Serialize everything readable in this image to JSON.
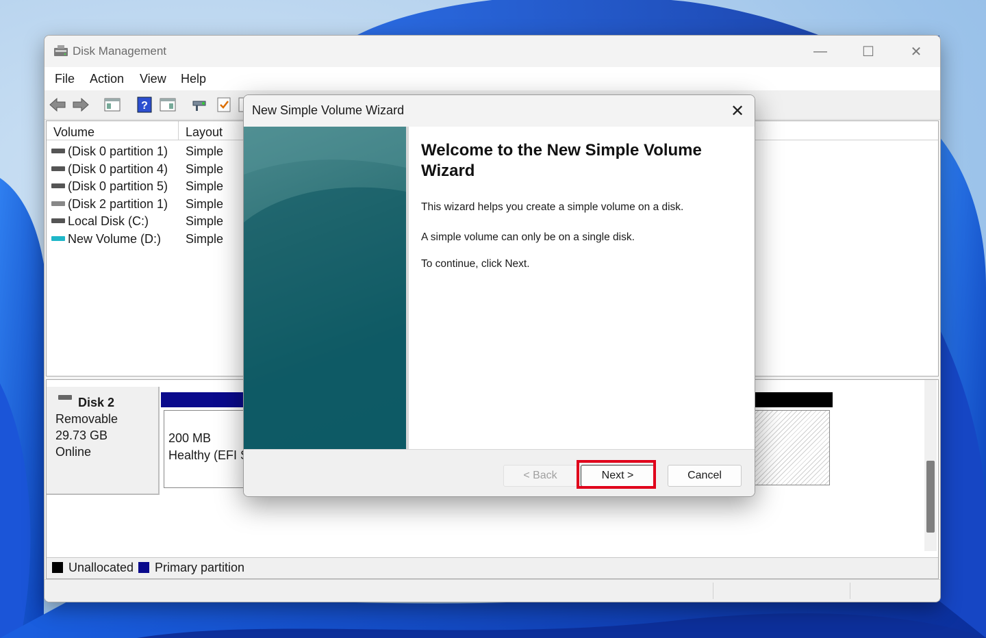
{
  "window": {
    "title": "Disk Management",
    "controls": {
      "minimize": "—",
      "maximize": "☐",
      "close": "✕"
    }
  },
  "menu": [
    "File",
    "Action",
    "View",
    "Help"
  ],
  "toolbar": [
    "back-arrow-icon",
    "forward-arrow-icon",
    "properties-pane-icon",
    "help-icon",
    "show-pane-icon",
    "connect-icon",
    "check-icon",
    "more-icon"
  ],
  "volume_list": {
    "columns": [
      "Volume",
      "Layout"
    ],
    "rows": [
      {
        "name": "(Disk 0 partition 1)",
        "layout": "Simple",
        "icon": "disk-icon"
      },
      {
        "name": "(Disk 0 partition 4)",
        "layout": "Simple",
        "icon": "disk-icon"
      },
      {
        "name": "(Disk 0 partition 5)",
        "layout": "Simple",
        "icon": "disk-icon"
      },
      {
        "name": "(Disk 2 partition 1)",
        "layout": "Simple",
        "icon": "disk-icon"
      },
      {
        "name": "Local Disk (C:)",
        "layout": "Simple",
        "icon": "disk-icon"
      },
      {
        "name": "New Volume (D:)",
        "layout": "Simple",
        "icon": "usb-disk-icon"
      }
    ]
  },
  "disk_map": {
    "disk": {
      "name": "Disk 2",
      "type": "Removable",
      "size": "29.73 GB",
      "status": "Online"
    },
    "partition": {
      "size": "200 MB",
      "status": "Healthy (EFI S"
    }
  },
  "legend": {
    "unallocated": "Unallocated",
    "primary": "Primary partition",
    "unallocated_color": "#000000",
    "primary_color": "#0a0a8c"
  },
  "dialog": {
    "title": "New Simple Volume Wizard",
    "heading": "Welcome to the New Simple Volume Wizard",
    "paragraphs": [
      "This wizard helps you create a simple volume on a disk.",
      "A simple volume can only be on a single disk.",
      "To continue, click Next."
    ],
    "buttons": {
      "back": "< Back",
      "next": "Next >",
      "cancel": "Cancel"
    },
    "close": "✕"
  },
  "colors": {
    "highlight": "#e0001b",
    "sidebar_teal": "#11606a"
  }
}
